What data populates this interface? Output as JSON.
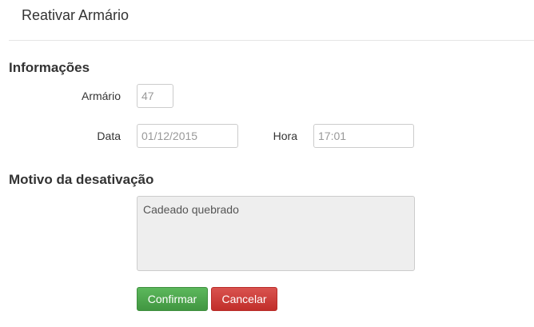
{
  "modal": {
    "title": "Reativar Armário"
  },
  "info_section": {
    "title": "Informações",
    "armario_label": "Armário",
    "armario_value": "47",
    "data_label": "Data",
    "data_value": "01/12/2015",
    "hora_label": "Hora",
    "hora_value": "17:01"
  },
  "motivo_section": {
    "title": "Motivo da desativação",
    "text": "Cadeado quebrado"
  },
  "actions": {
    "confirm_label": "Confirmar",
    "cancel_label": "Cancelar"
  },
  "colors": {
    "confirm": "#5cb85c",
    "cancel": "#d9534f"
  }
}
